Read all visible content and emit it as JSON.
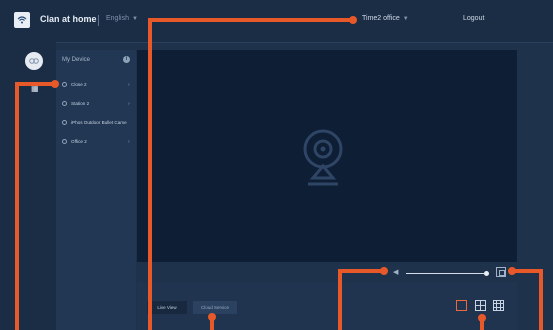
{
  "header": {
    "app_title": "Clan at home",
    "language": "English",
    "office": "Time2 office",
    "logout": "Logout"
  },
  "sidebar": {
    "title": "My Device",
    "devices": [
      {
        "label": "Close 2"
      },
      {
        "label": "Station 2"
      },
      {
        "label": "iPhos Outdoor Bullet Came"
      },
      {
        "label": "Office 2"
      }
    ]
  },
  "bottom": {
    "tab_live": "Live View",
    "tab_cloud": "Cloud Service"
  },
  "icons": [
    "wifi-icon",
    "avatar-icon",
    "list-icon",
    "info-icon",
    "camera-placeholder-icon",
    "speaker-icon",
    "grid-toggle-icon",
    "layout-1-icon",
    "layout-4-icon",
    "layout-9-icon"
  ],
  "colors": {
    "accent": "#e8592a",
    "background": "#1f324c",
    "video": "#0d1e35"
  }
}
